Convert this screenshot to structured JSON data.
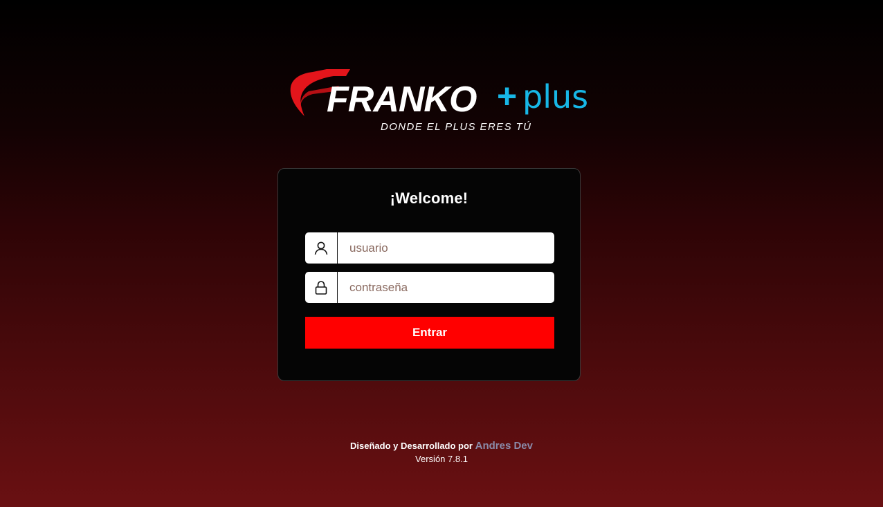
{
  "brand": {
    "name": "FRANKO",
    "plus_text": "plus",
    "tagline": "DONDE EL PLUS ERES TÚ",
    "colors": {
      "red": "#e3151b",
      "cyan": "#17b7e6",
      "white": "#ffffff"
    }
  },
  "login": {
    "title": "¡Welcome!",
    "username": {
      "icon": "user-icon",
      "placeholder": "usuario",
      "value": ""
    },
    "password": {
      "icon": "lock-icon",
      "placeholder": "contraseña",
      "value": ""
    },
    "submit_label": "Entrar",
    "accent": "#ff0000"
  },
  "footer": {
    "credit_prefix": "Diseñado y Desarrollado por",
    "author": "Andres Dev",
    "version": "Versión 7.8.1"
  }
}
